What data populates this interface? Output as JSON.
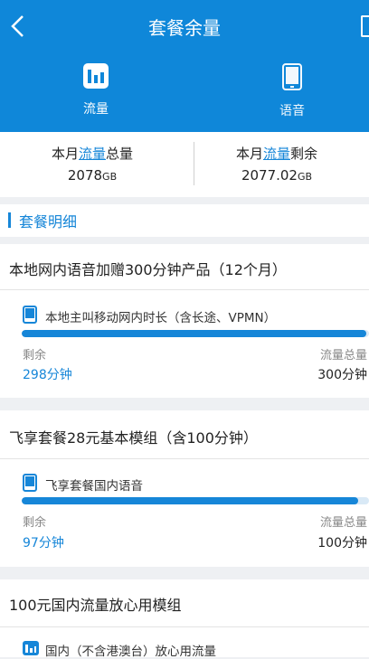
{
  "header": {
    "title": "套餐余量",
    "tabs": [
      {
        "label": "流量",
        "icon": "bar-chart-icon",
        "active": true
      },
      {
        "label": "语音",
        "icon": "phone-icon",
        "active": false
      }
    ],
    "color": "#0f87d9"
  },
  "summary": {
    "total_prefix": "本月",
    "total_hl": "流量",
    "total_suffix": "总量",
    "total_value": "2078",
    "total_unit": "GB",
    "remain_prefix": "本月",
    "remain_hl": "流量",
    "remain_suffix": "剩余",
    "remain_value": "2077.02",
    "remain_unit": "GB"
  },
  "section_title": "套餐明细",
  "packages": [
    {
      "title": "本地网内语音加赠300分钟产品（12个月）",
      "item_label": "本地主叫移动网内时长（含长途、VPMN）",
      "icon": "phone-icon",
      "remain_label": "剩余",
      "remain_value": "298分钟",
      "total_label": "流量总量",
      "total_value": "300分钟",
      "fraction_remaining": 0.993
    },
    {
      "title": "飞享套餐28元基本模组（含100分钟）",
      "item_label": "飞享套餐国内语音",
      "icon": "phone-icon",
      "remain_label": "剩余",
      "remain_value": "97分钟",
      "total_label": "流量总量",
      "total_value": "100分钟",
      "fraction_remaining": 0.97
    },
    {
      "title": "100元国内流量放心用模组",
      "item_label": "国内（不含港澳台）放心用流量",
      "icon": "bar-chart-icon"
    }
  ]
}
